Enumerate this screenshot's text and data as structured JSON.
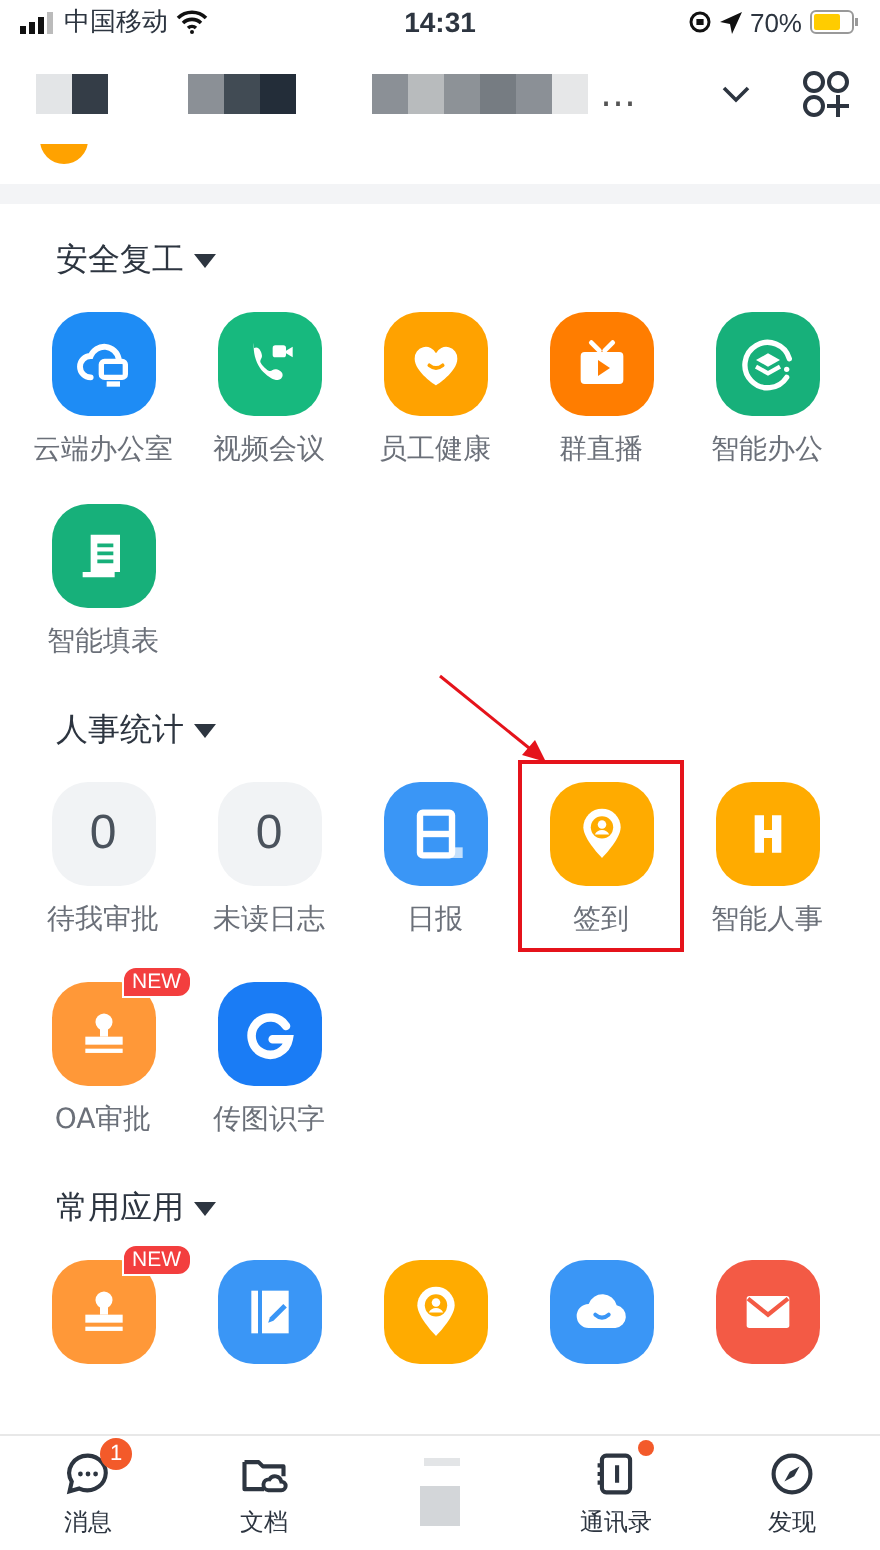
{
  "status_bar": {
    "carrier": "中国移动",
    "time": "14:31",
    "battery": "70%"
  },
  "header": {
    "title_tail": "…"
  },
  "sections": [
    {
      "title": "安全复工",
      "items": [
        {
          "kind": "cloud",
          "color": "#1e8cf5",
          "label": "云端办公室"
        },
        {
          "kind": "video",
          "color": "#17b97e",
          "label": "视频会议"
        },
        {
          "kind": "heart",
          "color": "#ffa200",
          "label": "员工健康"
        },
        {
          "kind": "tv",
          "color": "#ff7d00",
          "label": "群直播"
        },
        {
          "kind": "layers",
          "color": "#17b07a",
          "label": "智能办公"
        },
        {
          "kind": "form",
          "color": "#17b07a",
          "label": "智能填表"
        }
      ]
    },
    {
      "title": "人事统计",
      "items": [
        {
          "kind": "counter",
          "value": "0",
          "label": "待我审批"
        },
        {
          "kind": "counter",
          "value": "0",
          "label": "未读日志"
        },
        {
          "kind": "calendar",
          "color": "#3a96f6",
          "label": "日报"
        },
        {
          "kind": "pin",
          "color": "#ffab00",
          "label": "签到",
          "highlighted": true
        },
        {
          "kind": "h",
          "color": "#ffab00",
          "label": "智能人事"
        },
        {
          "kind": "stamp",
          "color": "#ff9838",
          "label": "OA审批",
          "badge": "NEW"
        },
        {
          "kind": "g",
          "color": "#1a7cf5",
          "label": "传图识字"
        }
      ]
    },
    {
      "title": "常用应用",
      "items": [
        {
          "kind": "stamp",
          "color": "#ff9838",
          "badge": "NEW"
        },
        {
          "kind": "notebook",
          "color": "#3a96f6"
        },
        {
          "kind": "pin",
          "color": "#ffab00"
        },
        {
          "kind": "cloud-smile",
          "color": "#3a96f6"
        },
        {
          "kind": "mail",
          "color": "#f35a45"
        }
      ]
    }
  ],
  "tab_bar": [
    {
      "kind": "chat",
      "label": "消息",
      "badge": "1"
    },
    {
      "kind": "folder",
      "label": "文档"
    },
    {
      "kind": "blurred"
    },
    {
      "kind": "contacts",
      "label": "通讯录",
      "dot": true
    },
    {
      "kind": "compass",
      "label": "发现"
    }
  ]
}
